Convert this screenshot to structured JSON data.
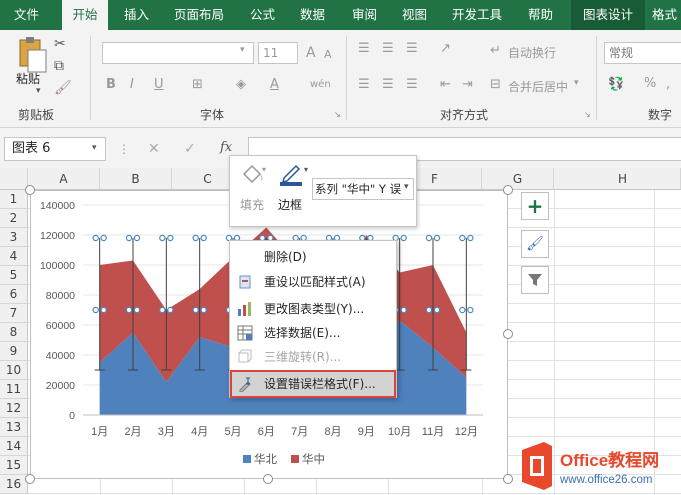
{
  "ribbon_tabs": [
    "文件",
    "开始",
    "插入",
    "页面布局",
    "公式",
    "数据",
    "审阅",
    "视图",
    "开发工具",
    "帮助",
    "图表设计",
    "格式"
  ],
  "active_tab": "开始",
  "clipboard": {
    "paste": "粘贴",
    "group": "剪贴板"
  },
  "font": {
    "size": "11",
    "bold": "B",
    "italic": "I",
    "underline": "U",
    "increase": "A",
    "decrease": "A",
    "wen": "wén",
    "group": "字体"
  },
  "alignment": {
    "wrap": "自动换行",
    "merge": "合并后居中",
    "group": "对齐方式"
  },
  "number": {
    "format": "常规",
    "percent": "%",
    "group": "数字"
  },
  "name_box": "图表 6",
  "fx": "fx",
  "mini_toolbar": {
    "fill": "填充",
    "outline": "边框",
    "series_select": "系列 \"华中\" Y 误"
  },
  "columns": [
    "A",
    "B",
    "C",
    "D",
    "E",
    "F",
    "G",
    "H"
  ],
  "rows": [
    "1",
    "2",
    "3",
    "4",
    "5",
    "6",
    "7",
    "8",
    "9",
    "10",
    "11",
    "12",
    "13",
    "14",
    "15",
    "16"
  ],
  "context_menu": [
    {
      "label": "删除(D)",
      "enabled": true
    },
    {
      "label": "重设以匹配样式(A)",
      "enabled": true
    },
    {
      "label": "更改图表类型(Y)...",
      "enabled": true
    },
    {
      "label": "选择数据(E)...",
      "enabled": true
    },
    {
      "label": "三维旋转(R)...",
      "enabled": false
    },
    {
      "label": "设置错误栏格式(F)...",
      "enabled": true,
      "highlighted": true
    }
  ],
  "chart_data": {
    "type": "area",
    "stacked": true,
    "categories": [
      "1月",
      "2月",
      "3月",
      "4月",
      "5月",
      "6月",
      "7月",
      "8月",
      "9月",
      "10月",
      "11月",
      "12月"
    ],
    "series": [
      {
        "name": "华北",
        "color": "#4f81bd",
        "values": [
          35000,
          55000,
          22000,
          52000,
          45000,
          70000,
          55000,
          45000,
          50000,
          63000,
          45000,
          25000
        ]
      },
      {
        "name": "华中",
        "color": "#c0504d",
        "values": [
          65000,
          48000,
          48000,
          32000,
          60000,
          55000,
          45000,
          40000,
          70000,
          32000,
          55000,
          30000
        ]
      }
    ],
    "yticks": [
      "0",
      "20000",
      "40000",
      "60000",
      "80000",
      "100000",
      "120000",
      "140000"
    ],
    "ylim": [
      0,
      140000
    ],
    "error_bars": {
      "upper": 118000,
      "middle": 70000,
      "lower": 30000,
      "color": "#4a8ac4"
    },
    "legend": "bottom"
  },
  "watermark": {
    "brand": "Office教程网",
    "url": "www.office26.com"
  },
  "colors": {
    "excel_green": "#217346",
    "ctx_tab": "#185c37",
    "highlight_border": "#d9453b"
  }
}
